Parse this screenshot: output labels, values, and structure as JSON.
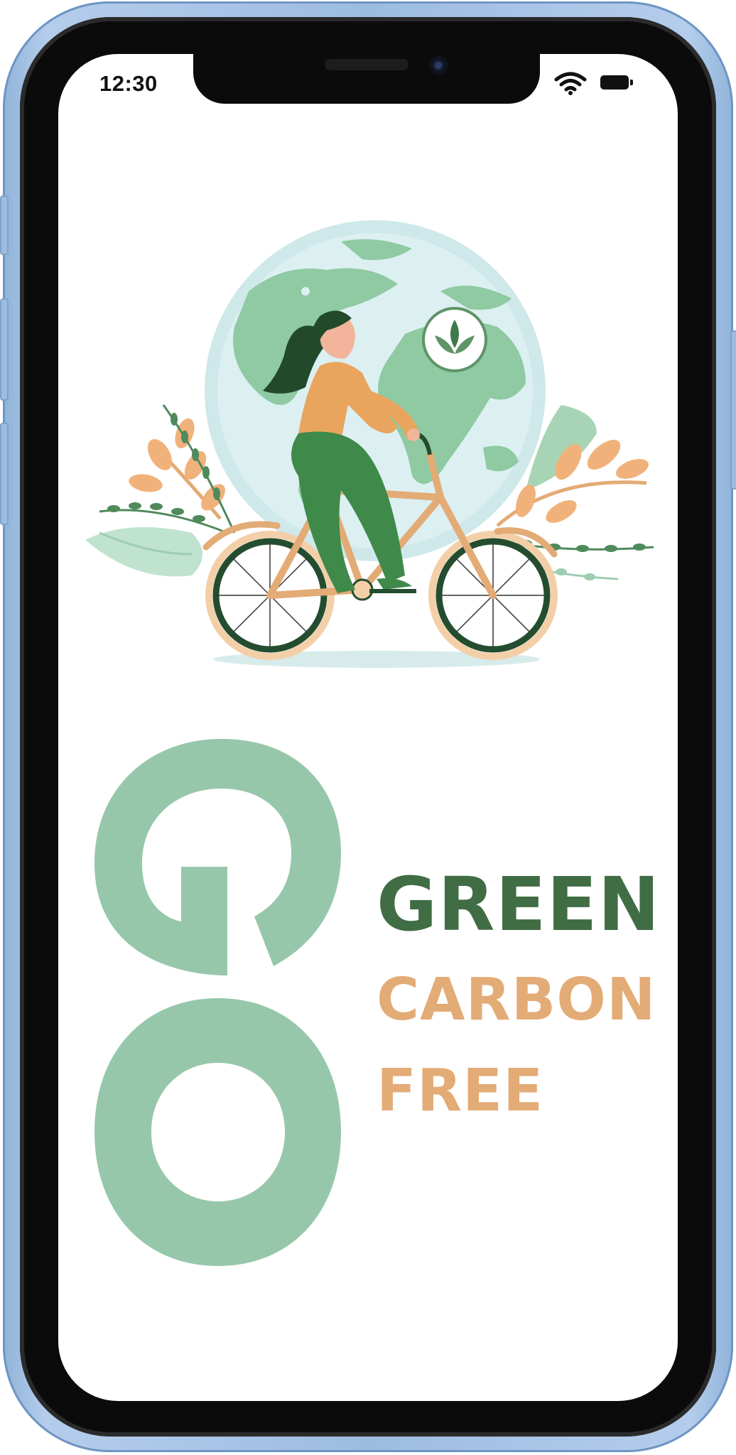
{
  "status_bar": {
    "time": "12:30",
    "wifi_icon": "wifi-icon",
    "battery_icon": "battery-icon"
  },
  "poster": {
    "big_word": "GO",
    "lines": [
      "GREEN",
      "CARBON",
      "FREE"
    ]
  },
  "illustration": {
    "description_icons": [
      "globe",
      "woman-cyclist",
      "bicycle",
      "leaf-badge-icon",
      "foliage"
    ]
  },
  "colors": {
    "frame": "#9dbce0",
    "go_green": "#97c7ab",
    "dark_green": "#416d45",
    "orange": "#e3ab76",
    "globe_water": "#d6edf0",
    "globe_land": "#8fcaa2"
  }
}
